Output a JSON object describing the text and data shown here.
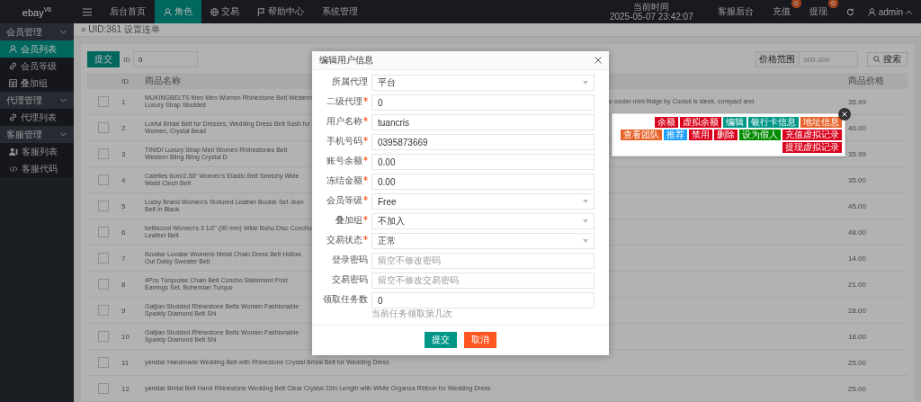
{
  "topbar": {
    "logo": "ebay",
    "logo_sup": "V6",
    "nav": [
      {
        "label": "后台首页",
        "selected": false
      },
      {
        "label": "角色",
        "selected": true
      },
      {
        "label": "交易",
        "selected": false
      },
      {
        "label": "帮助中心",
        "selected": false
      },
      {
        "label": "系统管理",
        "selected": false
      }
    ],
    "clock": {
      "label": "当前时间",
      "value": "2025-05-07 23:42:07"
    },
    "links": [
      {
        "label": "客服后台"
      },
      {
        "label": "充值",
        "badge": "0"
      },
      {
        "label": "提现",
        "badge": "0"
      }
    ],
    "user": "admin"
  },
  "sidebar": [
    {
      "label": "会员管理",
      "expanded": true,
      "children": [
        {
          "label": "会员列表",
          "selected": true
        },
        {
          "label": "会员等级",
          "selected": false
        },
        {
          "label": "叠加组",
          "selected": false
        }
      ]
    },
    {
      "label": "代理管理",
      "expanded": true,
      "children": [
        {
          "label": "代理列表",
          "selected": false
        }
      ]
    },
    {
      "label": "客服管理",
      "expanded": true,
      "children": [
        {
          "label": "客服列表",
          "selected": false
        },
        {
          "label": "客服代码",
          "selected": false
        }
      ]
    }
  ],
  "breadcrumb": "» UID:361 设置连单",
  "toolbar": {
    "submit": "提交",
    "id_label": "ID",
    "id_value": "0",
    "price_label": "价格范围",
    "price_placeholder": "300-300",
    "search": "搜索"
  },
  "table": {
    "columns": [
      "ID",
      "商品名称",
      "商品价格"
    ],
    "rows": [
      {
        "id": "1",
        "name": "MUKINGBELTS Men Men Women Rhinestone Belt Western Luxury Strap Studded",
        "name_tail": "e cooler mini fridge by Cooluli is sleek, compact and",
        "price": "35.99",
        "checked": false
      },
      {
        "id": "2",
        "name": "Lovful Bridal Belt for Dresses, Wedding Dress Belt Sash for Women, Crystal Bead",
        "price": "40.00",
        "checked": false
      },
      {
        "id": "3",
        "name": "TINIDI Luxury Strap Men Women Rhinestones Belt Western Bling Bling Crystal D",
        "price": "35.99",
        "checked": false
      },
      {
        "id": "4",
        "name": "Catelles 6cm/2.36\" Women's Elastic Belt Stretchy Wide Waist Cinch Belt",
        "price": "35.00",
        "checked": false
      },
      {
        "id": "5",
        "name": "Lucky Brand Women's Textured Leather Buckle Set Jean Belt in Black",
        "price": "45.00",
        "checked": false
      },
      {
        "id": "6",
        "name": "beltiscool Women's 3 1/2\" (90 mm) Wide Boho Disc Concho Leather Belt",
        "price": "48.00",
        "checked": false
      },
      {
        "id": "7",
        "name": "Iluvatar Luvatar Womens Metal Chain Dress Belt Hollow Out Daisy Sweater Belt",
        "price": "14.00",
        "checked": false
      },
      {
        "id": "8",
        "name": "4Pcs Turquoise Chain Belt Concho Statement Post Earrings Set, Bohemian Turquo",
        "price": "21.00",
        "checked": false
      },
      {
        "id": "9",
        "name": "Gatjian Studded Rhinestone Belts Women Fashionable Sparkly Diamond Belt Shi",
        "price": "28.00",
        "checked": false
      },
      {
        "id": "10",
        "name": "Gatjian Studded Rhinestone Belts Women Fashionable Sparkly Diamond Belt Shi",
        "price": "18.00",
        "checked": false
      },
      {
        "id": "11",
        "name": "yanstar Handmade Wedding Belt with Rhinestone Crystal Bridal Belt for Wedding Dress",
        "price": "25.00",
        "checked": false
      },
      {
        "id": "12",
        "name": "yanstar Bridal Belt Hand Rhinestone Wedding Belt Clear Crystal 22In Length with White Organza Ribbon for Wedding Dress",
        "price": "25.00",
        "checked": false
      }
    ]
  },
  "actions": [
    {
      "label": "余额",
      "color": "#d9001b"
    },
    {
      "label": "虚拟余额",
      "color": "#d9001b"
    },
    {
      "label": "编辑",
      "color": "#009688"
    },
    {
      "label": "银行卡信息",
      "color": "#009688"
    },
    {
      "label": "地址信息",
      "color": "#e8632a"
    },
    {
      "label": "查看团队",
      "color": "#e8632a"
    },
    {
      "label": "推荐",
      "color": "#1e9fff"
    },
    {
      "label": "禁用",
      "color": "#d9001b"
    },
    {
      "label": "删除",
      "color": "#d9001b"
    },
    {
      "label": "设为假人",
      "color": "#008a00"
    },
    {
      "label": "充值虚拟记录",
      "color": "#d9001b"
    },
    {
      "label": "提现虚拟记录",
      "color": "#d9001b"
    }
  ],
  "modal": {
    "title": "编辑用户信息",
    "fields": [
      {
        "label": "所属代理",
        "kind": "select",
        "required": false,
        "value": "平台"
      },
      {
        "label": "二级代理",
        "kind": "input",
        "required": true,
        "value": "0"
      },
      {
        "label": "用户名称",
        "kind": "input",
        "required": true,
        "value": "tuancris"
      },
      {
        "label": "手机号码",
        "kind": "input",
        "required": true,
        "value": "0395873669"
      },
      {
        "label": "账号余额",
        "kind": "input",
        "required": true,
        "value": "0.00"
      },
      {
        "label": "冻结金额",
        "kind": "input",
        "required": true,
        "value": "0.00"
      },
      {
        "label": "会员等级",
        "kind": "select",
        "required": true,
        "value": "Free"
      },
      {
        "label": "叠加组",
        "kind": "select",
        "required": true,
        "value": "不加入"
      },
      {
        "label": "交易状态",
        "kind": "select",
        "required": true,
        "value": "正常"
      },
      {
        "label": "登录密码",
        "kind": "input",
        "required": false,
        "placeholder": "留空不修改密码"
      },
      {
        "label": "交易密码",
        "kind": "input",
        "required": false,
        "placeholder": "留空不修改交易密码"
      },
      {
        "label": "领取任务数",
        "kind": "input",
        "required": false,
        "value": "0",
        "help": "当前任务领取第几次"
      }
    ],
    "buttons": [
      {
        "label": "提交",
        "kind": "primary"
      },
      {
        "label": "取消",
        "kind": "danger"
      }
    ]
  }
}
